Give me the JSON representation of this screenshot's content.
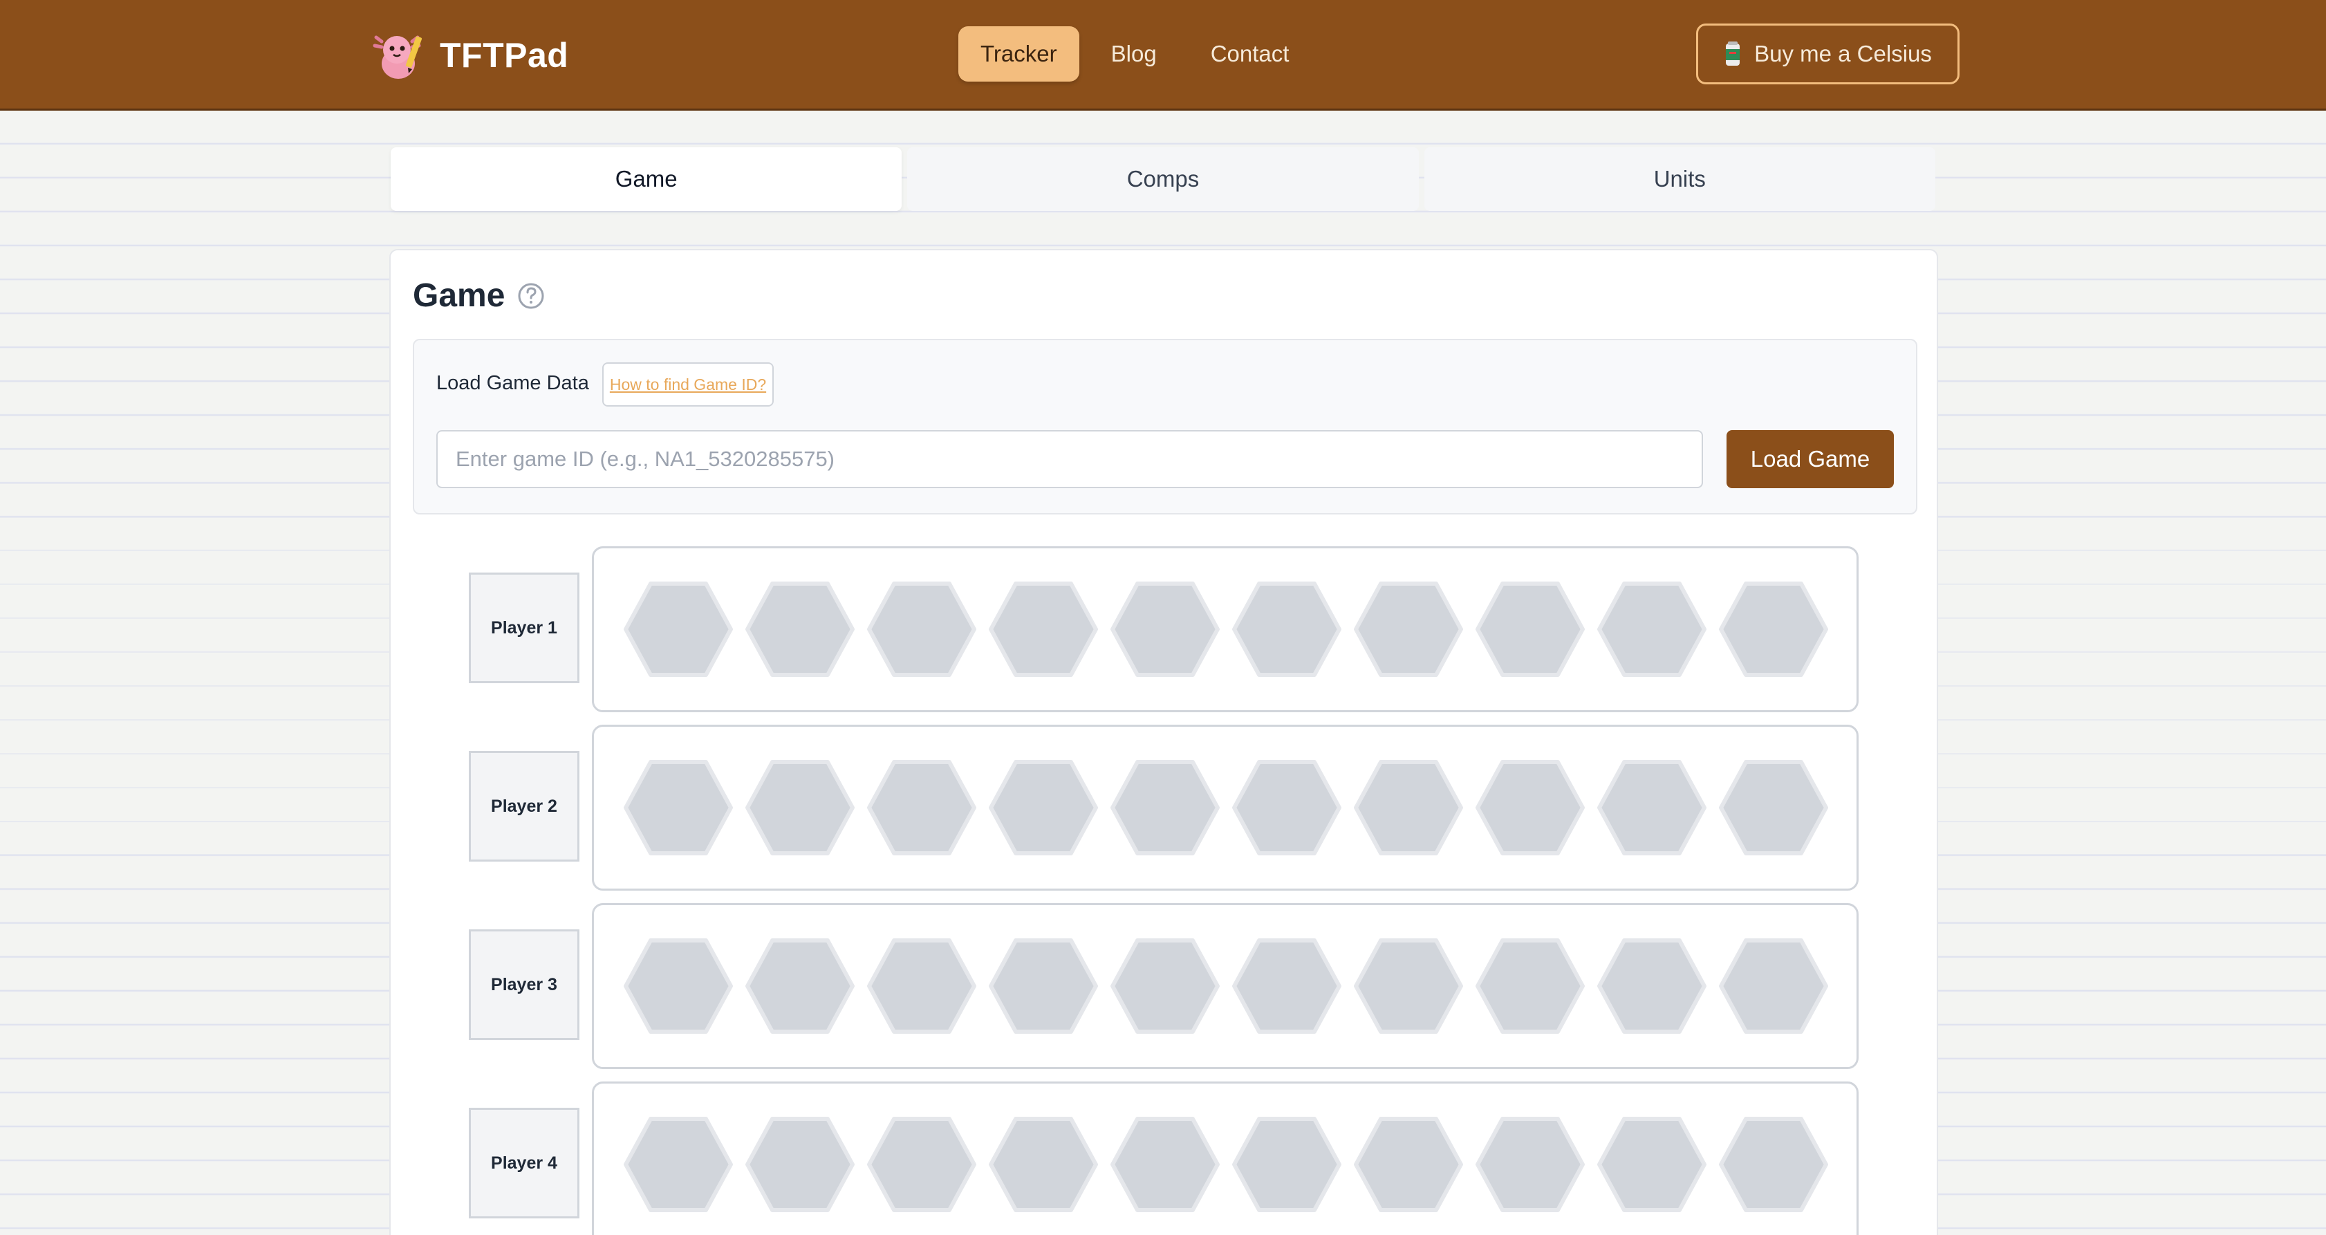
{
  "header": {
    "brand": "TFTPad",
    "logo_icon": "axolotl-mascot-icon",
    "nav": [
      {
        "label": "Tracker",
        "active": true
      },
      {
        "label": "Blog",
        "active": false
      },
      {
        "label": "Contact",
        "active": false
      }
    ],
    "cta_label": "Buy me a Celsius",
    "cta_icon": "celsius-can-icon"
  },
  "tabs": [
    {
      "label": "Game",
      "active": true
    },
    {
      "label": "Comps",
      "active": false
    },
    {
      "label": "Units",
      "active": false
    }
  ],
  "game": {
    "title": "Game",
    "help_icon": "question-circle-icon",
    "load_label": "Load Game Data",
    "howto_link": "How to find Game ID?",
    "input_placeholder": "Enter game ID (e.g., NA1_5320285575)",
    "input_value": "",
    "load_button": "Load Game"
  },
  "players": [
    {
      "label": "Player 1",
      "slots": 10
    },
    {
      "label": "Player 2",
      "slots": 10
    },
    {
      "label": "Player 3",
      "slots": 10
    },
    {
      "label": "Player 4",
      "slots": 10
    }
  ],
  "colors": {
    "header_bg": "#8b4f1a",
    "accent": "#f3bd7e",
    "primary_button": "#8b4f1a",
    "hex_slot": "#d1d5db"
  }
}
